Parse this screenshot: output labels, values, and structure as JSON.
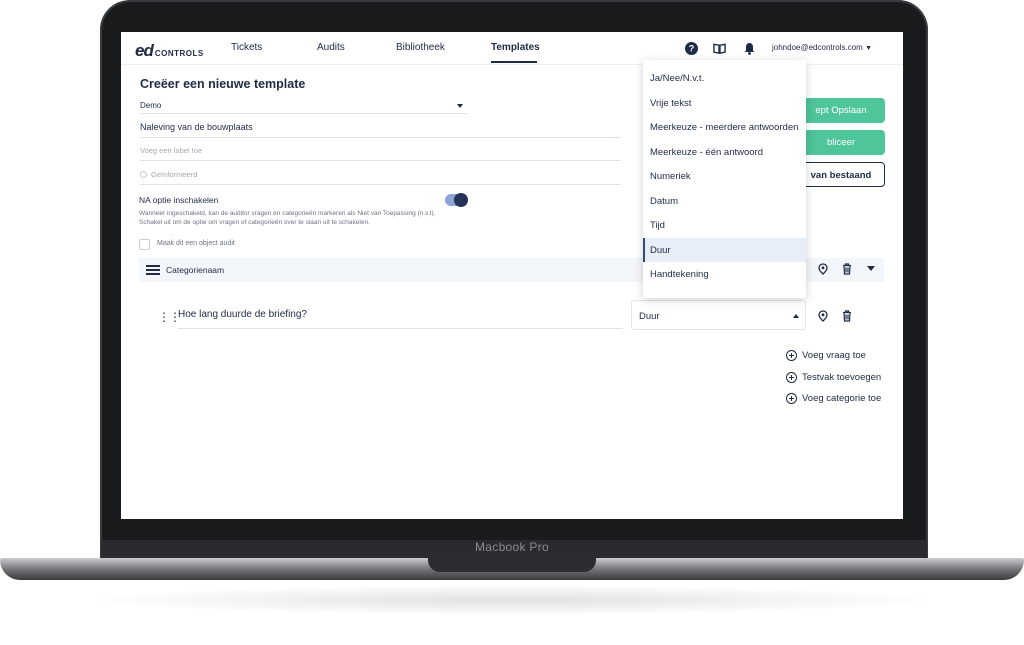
{
  "device": {
    "label": "Macbook Pro"
  },
  "nav": {
    "logo_mark": "ed",
    "logo_word": "CONTROLS",
    "links": [
      "Tickets",
      "Audits",
      "Bibliotheek",
      "Templates"
    ],
    "active": "Templates",
    "user": "johndoe@edcontrols.com"
  },
  "form": {
    "title": "Creëer een nieuwe template",
    "project": "Demo",
    "name": "Naleving van de bouwplaats",
    "label_placeholder": "Voeg een label toe",
    "status": "Geïnformeerd",
    "na_title": "NA optie inschakelen",
    "na_desc": "Wanneer ingeschakeld, kan de auditor vragen en categorieën markeren als Niet van Toepassing (n.v.t). Schakel uit om de optie om vragen of categorieën over te slaan uit te schakelen.",
    "na_enabled": true,
    "object_audit_label": "Maak dit een object audit",
    "object_audit_checked": false
  },
  "buttons": {
    "save_draft": "ept Opslaan",
    "publish": "bliceer",
    "from_file": "van bestaand"
  },
  "category": {
    "name": "Categorienaam"
  },
  "question": {
    "text": "Hoe lang duurde de briefing?",
    "type": "Duur"
  },
  "actions": [
    "Voeg vraag toe",
    "Testvak toevoegen",
    "Voeg categorie toe"
  ],
  "dropdown": {
    "options": [
      "Ja/Nee/N.v.t.",
      "Vrije tekst",
      "Meerkeuze - meerdere antwoorden",
      "Meerkeuze - één antwoord",
      "Numeriek",
      "Datum",
      "Tijd",
      "Duur",
      "Handtekening"
    ],
    "selected": "Duur"
  },
  "colors": {
    "primary": "#1f2a44",
    "accent_green": "#4fc59a",
    "toggle": "#8ea4d8"
  }
}
